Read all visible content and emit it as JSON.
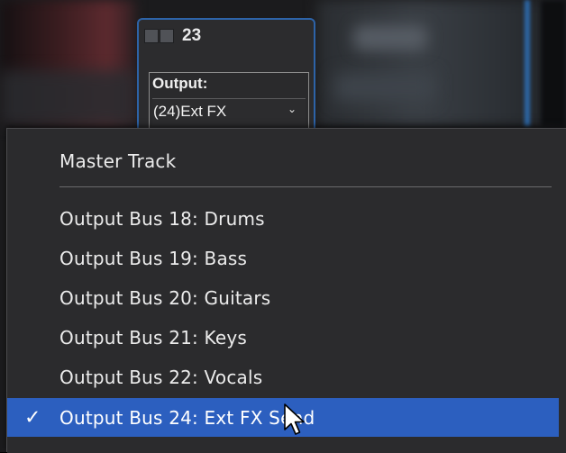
{
  "channel": {
    "number": "23",
    "output_label": "Output:",
    "output_value": "(24)Ext FX",
    "chevron_icon": "chevron-down-icon"
  },
  "menu": {
    "items": [
      {
        "label": "Master Track",
        "selected": false
      },
      {
        "label": "Output Bus 18: Drums",
        "selected": false
      },
      {
        "label": "Output Bus 19: Bass",
        "selected": false
      },
      {
        "label": "Output Bus 20: Guitars",
        "selected": false
      },
      {
        "label": "Output Bus 21: Keys",
        "selected": false
      },
      {
        "label": "Output Bus 22: Vocals",
        "selected": false
      },
      {
        "label": "Output Bus 24: Ext FX Send",
        "selected": true
      }
    ],
    "check_icon": "checkmark-icon"
  },
  "colors": {
    "accent": "#2c5fbf",
    "channel_border": "#2d63a8",
    "menu_bg": "#2b2b2d"
  }
}
